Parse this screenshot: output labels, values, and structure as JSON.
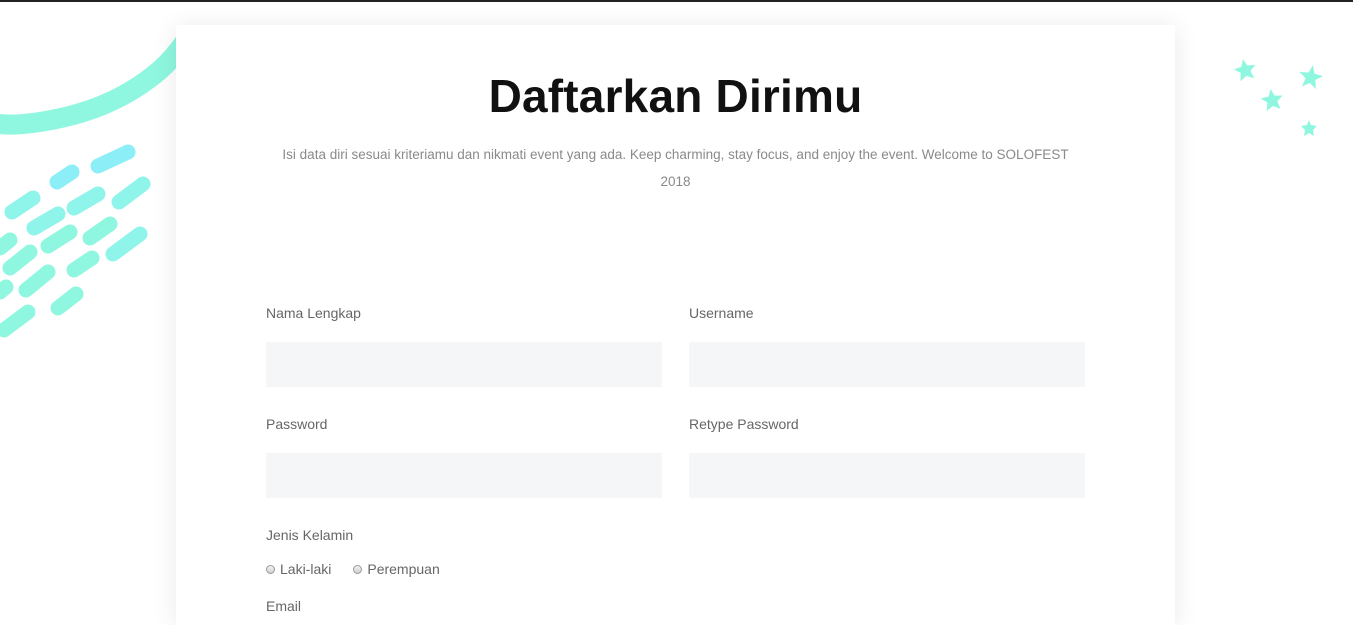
{
  "form": {
    "title": "Daftarkan Dirimu",
    "subtitle": "Isi data diri sesuai kriteriamu dan nikmati event yang ada. Keep charming, stay focus, and enjoy the event. Welcome to SOLOFEST 2018",
    "fields": {
      "full_name": {
        "label": "Nama Lengkap",
        "value": "",
        "placeholder": ""
      },
      "username": {
        "label": "Username",
        "value": "",
        "placeholder": ""
      },
      "password": {
        "label": "Password",
        "value": "",
        "placeholder": ""
      },
      "retype_password": {
        "label": "Retype Password",
        "value": "",
        "placeholder": ""
      }
    },
    "gender": {
      "label": "Jenis Kelamin",
      "options": [
        "Laki-laki",
        "Perempuan"
      ]
    },
    "email": {
      "label": "Email"
    }
  },
  "colors": {
    "accent_mint": "#8ff7df",
    "accent_cyan": "#8ceef6",
    "input_bg": "#f5f6f8",
    "title_text": "#111111",
    "label_text": "#666666"
  }
}
